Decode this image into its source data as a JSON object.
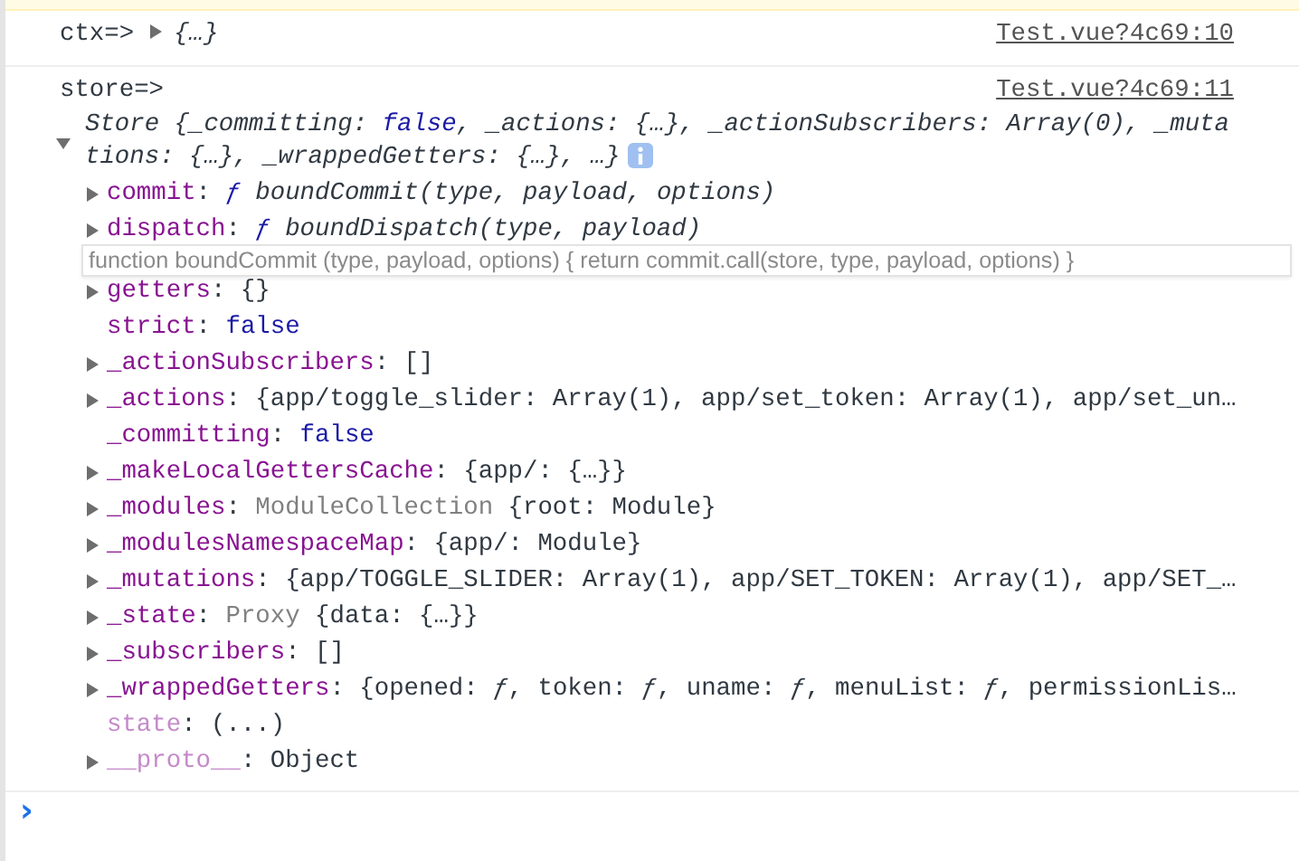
{
  "messages": [
    {
      "label": "ctx=>",
      "expanded": false,
      "preview": "{…}",
      "source": "Test.vue?4c69:10"
    },
    {
      "label": "store=>",
      "expanded": true,
      "source": "Test.vue?4c69:11",
      "summary": [
        {
          "text": "Store {_committing: ",
          "kind": "italic"
        },
        {
          "text": "false",
          "kind": "keyword-italic"
        },
        {
          "text": ", _actions: {…}, _actionSubscribers: Array(0), _mutations: {…}, _wrappedGetters: {…}, …}",
          "kind": "italic"
        }
      ],
      "properties": [
        {
          "expandable": true,
          "parts": [
            {
              "text": "commit",
              "kind": "key"
            },
            {
              "text": ": ",
              "kind": "plain"
            },
            {
              "text": "ƒ",
              "kind": "fn"
            },
            {
              "text": " boundCommit(type, payload, options)",
              "kind": "italic"
            }
          ]
        },
        {
          "expandable": true,
          "parts": [
            {
              "text": "dispatch",
              "kind": "key"
            },
            {
              "text": ": ",
              "kind": "plain"
            },
            {
              "text": "ƒ",
              "kind": "fn"
            },
            {
              "text": " boundDispatch(type, payload)",
              "kind": "italic"
            }
          ]
        },
        {
          "expandable": true,
          "parts": [
            {
              "text": "getters",
              "kind": "key"
            },
            {
              "text": ": {}",
              "kind": "plain"
            }
          ]
        },
        {
          "expandable": false,
          "parts": [
            {
              "text": "strict",
              "kind": "key"
            },
            {
              "text": ": ",
              "kind": "plain"
            },
            {
              "text": "false",
              "kind": "keyword"
            }
          ]
        },
        {
          "expandable": true,
          "parts": [
            {
              "text": "_actionSubscribers",
              "kind": "key"
            },
            {
              "text": ": []",
              "kind": "plain"
            }
          ]
        },
        {
          "expandable": true,
          "parts": [
            {
              "text": "_actions",
              "kind": "key"
            },
            {
              "text": ": {app/toggle_slider: Array(1), app/set_token: Array(1), app/set_un…",
              "kind": "plain"
            }
          ]
        },
        {
          "expandable": false,
          "parts": [
            {
              "text": "_committing",
              "kind": "key"
            },
            {
              "text": ": ",
              "kind": "plain"
            },
            {
              "text": "false",
              "kind": "keyword"
            }
          ]
        },
        {
          "expandable": true,
          "parts": [
            {
              "text": "_makeLocalGettersCache",
              "kind": "key"
            },
            {
              "text": ": {app/: {…}}",
              "kind": "plain"
            }
          ]
        },
        {
          "expandable": true,
          "parts": [
            {
              "text": "_modules",
              "kind": "key"
            },
            {
              "text": ": ",
              "kind": "plain"
            },
            {
              "text": "ModuleCollection",
              "kind": "type"
            },
            {
              "text": " {root: Module}",
              "kind": "plain"
            }
          ]
        },
        {
          "expandable": true,
          "parts": [
            {
              "text": "_modulesNamespaceMap",
              "kind": "key"
            },
            {
              "text": ": {app/: Module}",
              "kind": "plain"
            }
          ]
        },
        {
          "expandable": true,
          "parts": [
            {
              "text": "_mutations",
              "kind": "key"
            },
            {
              "text": ": {app/TOGGLE_SLIDER: Array(1), app/SET_TOKEN: Array(1), app/SET_…",
              "kind": "plain"
            }
          ]
        },
        {
          "expandable": true,
          "parts": [
            {
              "text": "_state",
              "kind": "key"
            },
            {
              "text": ": ",
              "kind": "plain"
            },
            {
              "text": "Proxy",
              "kind": "type"
            },
            {
              "text": " {data: {…}}",
              "kind": "plain"
            }
          ]
        },
        {
          "expandable": true,
          "parts": [
            {
              "text": "_subscribers",
              "kind": "key"
            },
            {
              "text": ": []",
              "kind": "plain"
            }
          ]
        },
        {
          "expandable": true,
          "parts": [
            {
              "text": "_wrappedGetters",
              "kind": "key"
            },
            {
              "text": ": {opened: ",
              "kind": "plain"
            },
            {
              "text": "ƒ",
              "kind": "italic"
            },
            {
              "text": ", token: ",
              "kind": "plain"
            },
            {
              "text": "ƒ",
              "kind": "italic"
            },
            {
              "text": ", uname: ",
              "kind": "plain"
            },
            {
              "text": "ƒ",
              "kind": "italic"
            },
            {
              "text": ", menuList: ",
              "kind": "plain"
            },
            {
              "text": "ƒ",
              "kind": "italic"
            },
            {
              "text": ", permissionLis…",
              "kind": "plain"
            }
          ]
        },
        {
          "expandable": false,
          "parts": [
            {
              "text": "state",
              "kind": "dim-key"
            },
            {
              "text": ": (...)",
              "kind": "plain"
            }
          ]
        },
        {
          "expandable": true,
          "parts": [
            {
              "text": "__proto__",
              "kind": "dim-key"
            },
            {
              "text": ": Object",
              "kind": "plain"
            }
          ]
        }
      ],
      "tooltip": "function boundCommit (type, payload, options) { return commit.call(store, type, payload, options) }"
    }
  ],
  "prompt": "›"
}
